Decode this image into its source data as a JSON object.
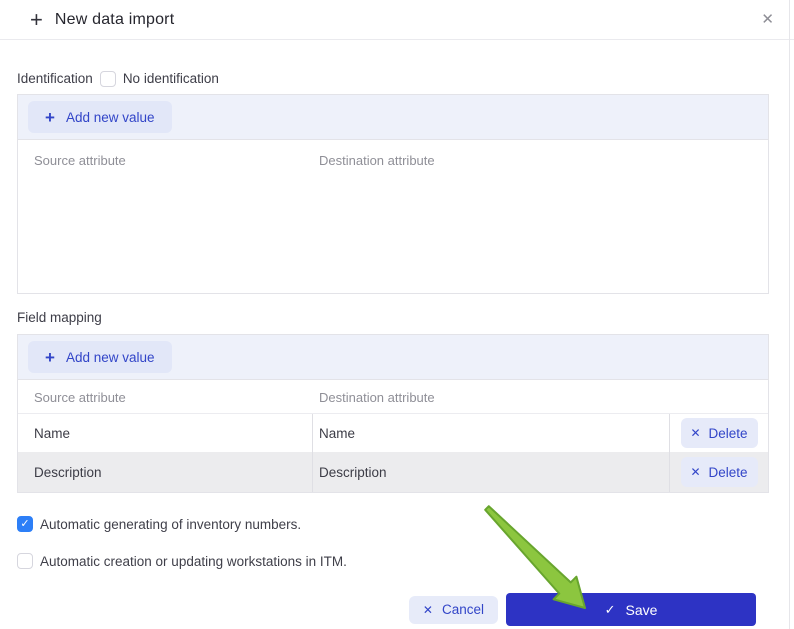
{
  "dialog": {
    "title": "New data import"
  },
  "icons": {
    "plus": "+",
    "close": "✕",
    "cancel_x": "✕",
    "delete_x": "✕",
    "check": "✓"
  },
  "identification": {
    "label": "Identification",
    "checkbox_label": "No identification",
    "checkbox_checked": false,
    "add_button_label": "Add new value",
    "columns": {
      "source": "Source attribute",
      "destination": "Destination attribute"
    },
    "rows": []
  },
  "field_mapping": {
    "label": "Field mapping",
    "add_button_label": "Add new value",
    "columns": {
      "source": "Source attribute",
      "destination": "Destination attribute"
    },
    "rows": [
      {
        "source": "Name",
        "destination": "Name",
        "action": "Delete"
      },
      {
        "source": "Description",
        "destination": "Description",
        "action": "Delete"
      }
    ]
  },
  "options": [
    {
      "label": "Automatic generating of inventory numbers.",
      "checked": true
    },
    {
      "label": "Automatic creation or updating workstations in ITM.",
      "checked": false
    }
  ],
  "footer": {
    "cancel_label": "Cancel",
    "save_label": "Save"
  },
  "colors": {
    "accent_blue": "#3245c8",
    "save_button": "#2d33c4",
    "checkbox_checked": "#2d7ff7",
    "strip_background": "#eef1fa",
    "light_button": "#e2e7f8",
    "row_alt_background": "#ececee",
    "arrow_green": "#8cc63f",
    "arrow_green_border": "#68a52e"
  }
}
